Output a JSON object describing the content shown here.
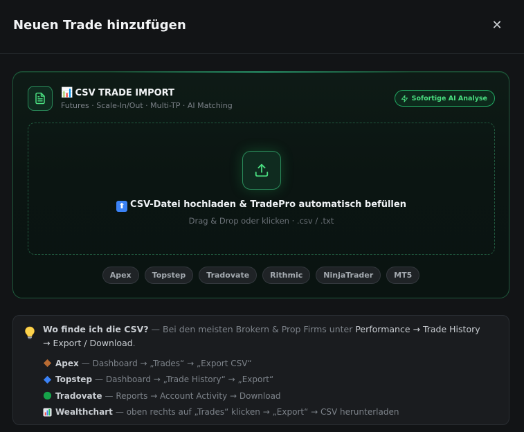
{
  "modal": {
    "title": "Neuen Trade hinzufügen",
    "close_glyph": "✕"
  },
  "import_card": {
    "title_emoji": "📊",
    "title": "CSV TRADE IMPORT",
    "subtitle": "Futures · Scale-In/Out · Multi-TP · AI Matching",
    "badge": "Sofortige AI Analyse",
    "icon": "file-text-icon"
  },
  "dropzone": {
    "title_emoji": "⬆",
    "title": "CSV-Datei hochladen & TradePro automatisch befüllen",
    "subtitle": "Drag & Drop oder klicken · .csv / .txt",
    "icon": "upload-icon"
  },
  "brokers": [
    "Apex",
    "Topstep",
    "Tradovate",
    "Rithmic",
    "NinjaTrader",
    "MT5"
  ],
  "help": {
    "icon": "lightbulb-icon",
    "question": "Wo finde ich die CSV?",
    "text_prefix": " — Bei den meisten Brokern & Prop Firms unter ",
    "text_path": "Performance → Trade History → Export / Download",
    "text_suffix": ".",
    "steps": [
      {
        "icon": "diamond-orange-icon",
        "color": "#c2763a",
        "broker": "Apex",
        "sep": "— ",
        "path": "Dashboard → „Trades“ → „Export CSV“"
      },
      {
        "icon": "diamond-blue-icon",
        "color": "#3b82f6",
        "broker": "Topstep",
        "sep": "— ",
        "path": "Dashboard → „Trade History“ → „Export“"
      },
      {
        "icon": "circle-green-icon",
        "color": "#16a34a",
        "broker": "Tradovate",
        "sep": "— ",
        "path": "Reports → Account Activity → Download"
      },
      {
        "icon": "chart-icon",
        "color": "#6b7280",
        "broker": "Wealthchart",
        "sep": "— ",
        "path": "oben rechts auf „Trades“ klicken → „Export“ → CSV herunterladen"
      }
    ]
  }
}
